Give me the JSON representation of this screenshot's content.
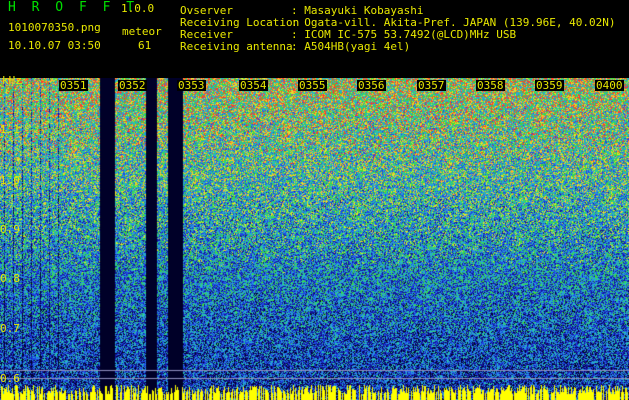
{
  "app": {
    "title": "H R O F F T",
    "version": "1.0.0"
  },
  "file": {
    "name": "1010070350.png",
    "datetime": "10.10.07 03:50"
  },
  "meteor": {
    "label": "meteor",
    "count": "61"
  },
  "info": [
    {
      "key": "Ovserver",
      "value": ": Masayuki Kobayashi"
    },
    {
      "key": "Receiving Location",
      "value": ": Ogata-vill. Akita-Pref. JAPAN (139.96E, 40.02N)"
    },
    {
      "key": "Receiver",
      "value": ": ICOM IC-575 53.7492(@LCD)MHz USB"
    },
    {
      "key": "Receiving antenna",
      "value": ": A504HB(yagi 4el)"
    }
  ],
  "axis": {
    "unit": "kHz",
    "y_ticks": [
      "1.1",
      "1.0",
      "0.9",
      "0.8",
      "0.7",
      "0.6"
    ],
    "x_ticks": [
      "0351",
      "0352",
      "0353",
      "0354",
      "0355",
      "0356",
      "0357",
      "0358",
      "0359",
      "0400"
    ]
  },
  "colors": {
    "text": "#e8e800",
    "title": "#00e000",
    "high": "#ff3030",
    "mid": "#30e030",
    "low": "#1040ff",
    "baseline": "#ffff00"
  }
}
